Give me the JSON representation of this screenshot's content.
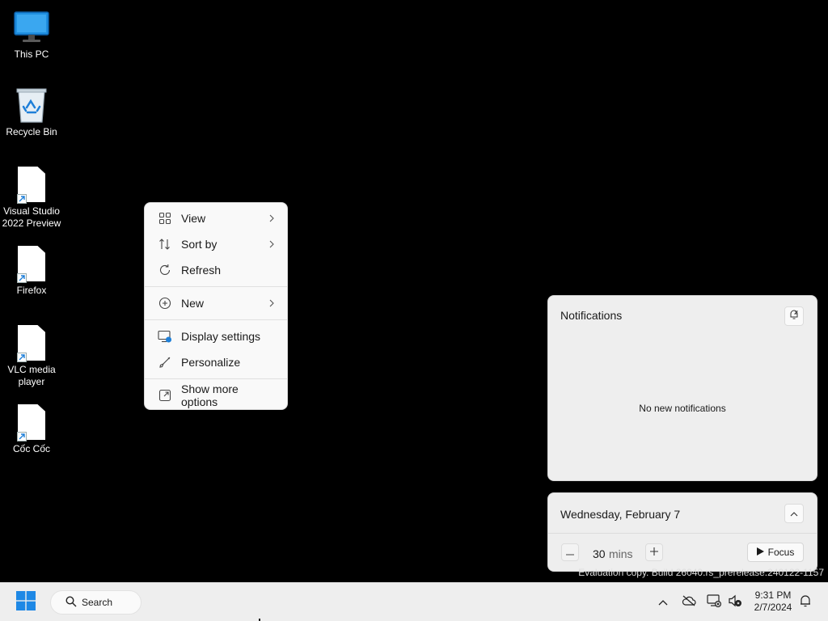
{
  "desktop": {
    "icons": [
      {
        "label": "This PC",
        "icon": "monitor-icon"
      },
      {
        "label": "Recycle Bin",
        "icon": "recycle-bin-icon"
      },
      {
        "label": "Visual Studio\n2022 Preview",
        "icon": "file-shortcut-icon"
      },
      {
        "label": "Firefox",
        "icon": "file-shortcut-icon"
      },
      {
        "label": "VLC media\nplayer",
        "icon": "file-shortcut-icon"
      },
      {
        "label": "Cốc Cốc",
        "icon": "file-shortcut-icon"
      }
    ]
  },
  "context_menu": {
    "items": [
      {
        "label": "View",
        "icon": "grid-icon",
        "submenu": true
      },
      {
        "label": "Sort by",
        "icon": "sort-icon",
        "submenu": true
      },
      {
        "label": "Refresh",
        "icon": "refresh-icon",
        "submenu": false
      },
      {
        "label": "New",
        "icon": "plus-circle-icon",
        "submenu": true
      },
      {
        "label": "Display settings",
        "icon": "display-settings-icon",
        "submenu": false
      },
      {
        "label": "Personalize",
        "icon": "brush-icon",
        "submenu": false
      },
      {
        "label": "Show more options",
        "icon": "external-icon",
        "submenu": false
      }
    ]
  },
  "notifications": {
    "title": "Notifications",
    "empty_text": "No new notifications"
  },
  "calendar": {
    "date": "Wednesday, February 7",
    "focus_minutes": "30",
    "focus_unit": "mins",
    "focus_label": "Focus"
  },
  "watermark": {
    "line2": "Evaluation copy. Build 26040.rs_prerelease.240122-1157"
  },
  "taskbar": {
    "search_label": "Search",
    "time": "9:31 PM",
    "date": "2/7/2024"
  },
  "colors": {
    "accent": "#0078d4",
    "desktop_background": "#000000",
    "taskbar_background": "#eeeeee"
  }
}
